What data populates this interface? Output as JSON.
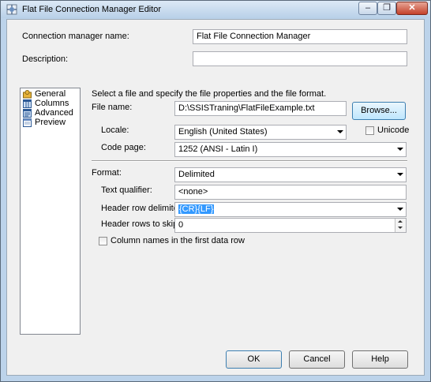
{
  "window": {
    "title": "Flat File Connection Manager Editor",
    "minimize_glyph": "–",
    "restore_glyph": "❐",
    "close_glyph": "✕"
  },
  "form": {
    "name_label": "Connection manager name:",
    "name_value": "Flat File Connection Manager",
    "description_label": "Description:",
    "description_value": ""
  },
  "nav": {
    "items": [
      {
        "label": "General",
        "icon": "general-icon"
      },
      {
        "label": "Columns",
        "icon": "columns-icon"
      },
      {
        "label": "Advanced",
        "icon": "advanced-icon"
      },
      {
        "label": "Preview",
        "icon": "preview-icon"
      }
    ]
  },
  "general": {
    "instruction": "Select a file and specify the file properties and the file format.",
    "file_name_label": "File name:",
    "file_name_value": "D:\\SSISTraning\\FlatFileExample.txt",
    "browse_label": "Browse...",
    "locale_label": "Locale:",
    "locale_value": "English (United States)",
    "unicode_label": "Unicode",
    "code_page_label": "Code page:",
    "code_page_value": "1252  (ANSI - Latin I)",
    "format_label": "Format:",
    "format_value": "Delimited",
    "text_qualifier_label": "Text qualifier:",
    "text_qualifier_value": "<none>",
    "header_row_delimiter_label": "Header row delimiter:",
    "header_row_delimiter_value": "{CR}{LF}",
    "header_rows_skip_label": "Header rows to skip:",
    "header_rows_skip_value": "0",
    "column_names_label": "Column names in the first data row"
  },
  "buttons": {
    "ok": "OK",
    "cancel": "Cancel",
    "help": "Help"
  },
  "colors": {
    "title_bar": "#bcd3ea",
    "selection": "#3399ff",
    "close_button": "#c4412a"
  }
}
